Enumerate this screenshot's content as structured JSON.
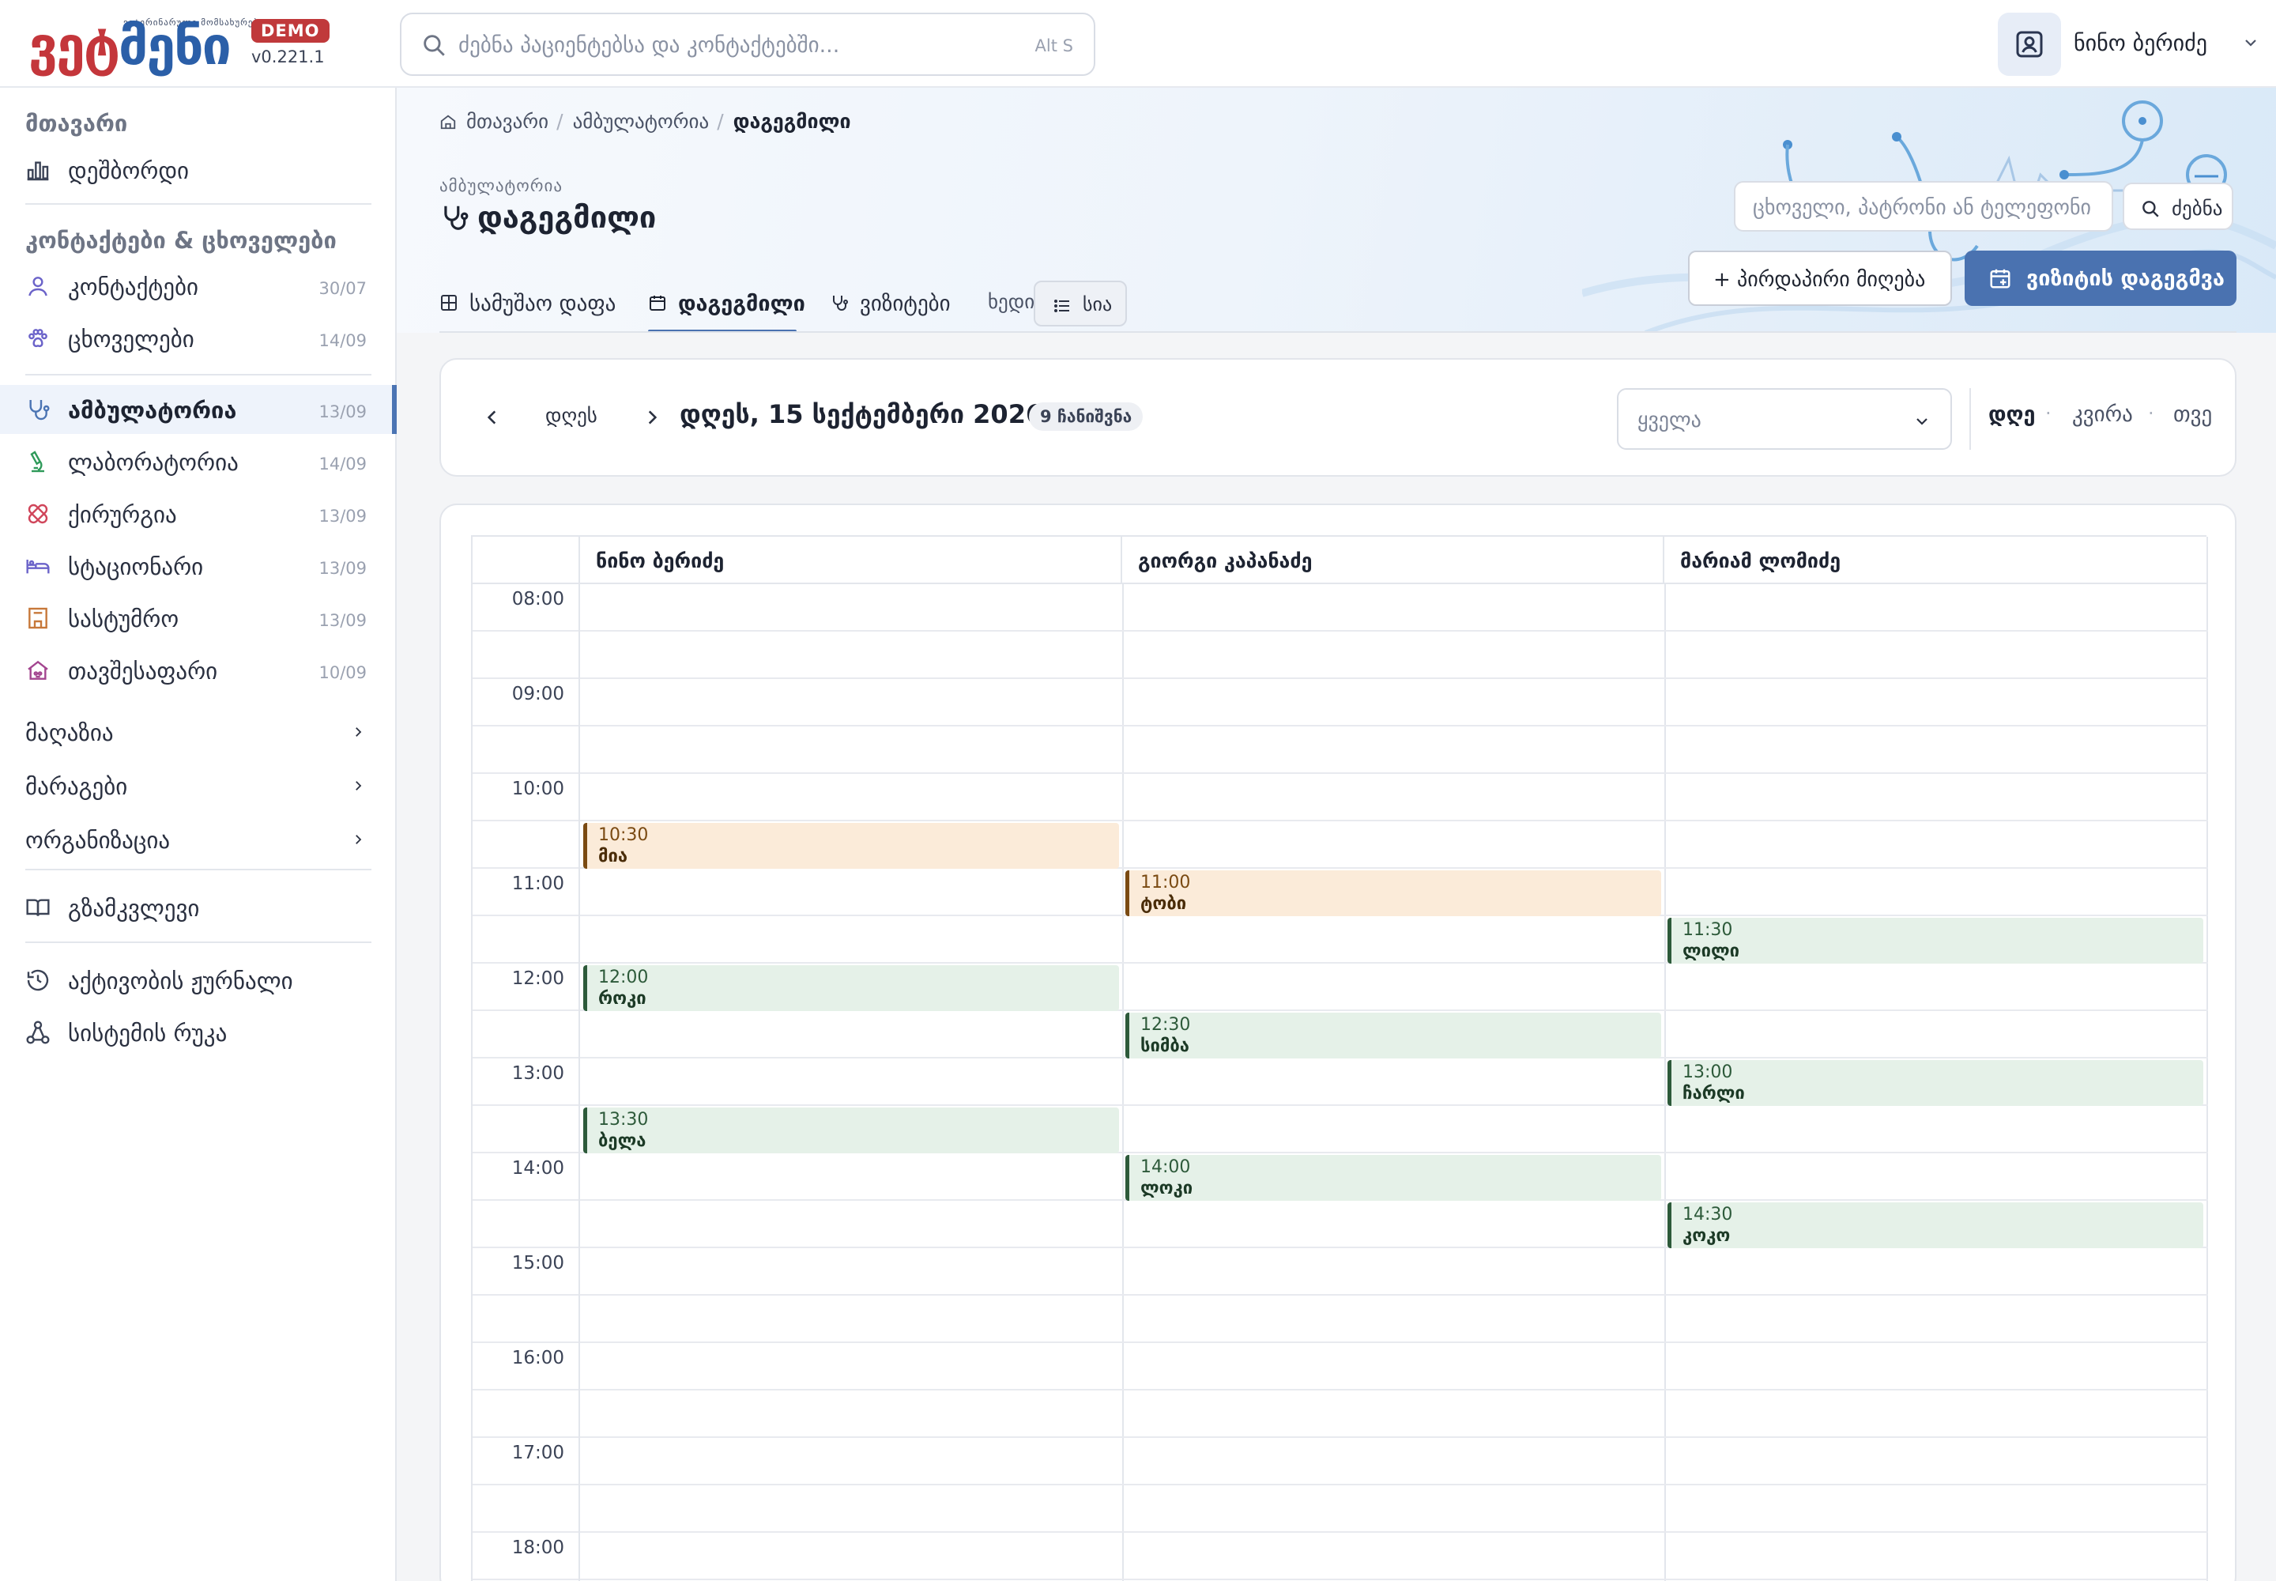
{
  "brand": {
    "tagline": "ვეტერინარული მომსახურება",
    "wordmark_a": "ვეტ",
    "wordmark_b": "მენი",
    "badge": "DEMO",
    "version": "v0.221.1"
  },
  "global_search": {
    "placeholder": "ძებნა პაციენტებსა და კონტაქტებში...",
    "shortcut": "Alt S"
  },
  "user": {
    "name": "ნინო ბერიძე",
    "icon": "user-badge-icon"
  },
  "sidebar": {
    "main_title": "მთავარი",
    "dashboard": "დეშბორდი",
    "contacts_title": "კონტაქტები & ცხოველები",
    "contacts": {
      "label": "კონტაქტები",
      "date": "30/07"
    },
    "animals": {
      "label": "ცხოველები",
      "date": "14/09"
    },
    "modules": [
      {
        "label": "ამბულატორია",
        "date": "13/09",
        "icon": "stethoscope-icon",
        "color": "#4b74b3"
      },
      {
        "label": "ლაბორატორია",
        "date": "14/09",
        "icon": "microscope-icon",
        "color": "#2f9a5a"
      },
      {
        "label": "ქირურგია",
        "date": "13/09",
        "icon": "bandage-icon",
        "color": "#d0455a"
      },
      {
        "label": "სტაციონარი",
        "date": "13/09",
        "icon": "bed-icon",
        "color": "#6b63c9"
      },
      {
        "label": "სასტუმრო",
        "date": "13/09",
        "icon": "hotel-icon",
        "color": "#c7783a"
      },
      {
        "label": "თავშესაფარი",
        "date": "10/09",
        "icon": "shelter-icon",
        "color": "#a3458f"
      }
    ],
    "shop": "მაღაზია",
    "stock": "მარაგები",
    "organization": "ორგანიზაცია",
    "guide": "გზამკვლევი",
    "activity_log": "აქტივობის ჟურნალი",
    "system_map": "სისტემის რუკა"
  },
  "header": {
    "breadcrumb": [
      "მთავარი",
      "ამბულატორია",
      "დაგეგმილი"
    ],
    "eyebrow": "ამბულატორია",
    "title": "დაგეგმილი",
    "search_placeholder": "ცხოველი, პატრონი ან ტელეფონი",
    "search_button": "ძებნა",
    "direct_button": "+ პირდაპირი მიღება",
    "plan_button": "ვიზიტის დაგეგმვა",
    "tabs": [
      "სამუშაო დაფა",
      "დაგეგმილი",
      "ვიზიტები"
    ],
    "view_label": "ხედი:",
    "view_button": "სია"
  },
  "date_nav": {
    "today": "დღეს",
    "date_label": "დღეს, 15 სექტემბერი 2026",
    "count_badge": "9 ჩანიშვნა",
    "filter_value": "ყველა",
    "modes": [
      "დღე",
      "კვირა",
      "თვე"
    ],
    "active_mode": "დღე"
  },
  "calendar": {
    "doctors": [
      "ნინო ბერიძე",
      "გიორგი კაპანაძე",
      "მარიამ ლომიძე"
    ],
    "hours": [
      "08:00",
      "09:00",
      "10:00",
      "11:00",
      "12:00",
      "13:00",
      "14:00",
      "15:00",
      "16:00",
      "17:00",
      "18:00"
    ],
    "slot_minutes": 30,
    "colors": {
      "pending_bg": "#fbebd9",
      "pending_border": "#7a4a12",
      "confirmed_bg": "#e5f1e8",
      "confirmed_border": "#2d5a3a"
    },
    "appointments": [
      {
        "doctor": 0,
        "time": "10:30",
        "pet": "მია",
        "status": "pending"
      },
      {
        "doctor": 1,
        "time": "11:00",
        "pet": "ტობი",
        "status": "pending"
      },
      {
        "doctor": 2,
        "time": "11:30",
        "pet": "ლილი",
        "status": "confirmed"
      },
      {
        "doctor": 0,
        "time": "12:00",
        "pet": "როკი",
        "status": "confirmed"
      },
      {
        "doctor": 1,
        "time": "12:30",
        "pet": "სიმბა",
        "status": "confirmed"
      },
      {
        "doctor": 2,
        "time": "13:00",
        "pet": "ჩარლი",
        "status": "confirmed"
      },
      {
        "doctor": 0,
        "time": "13:30",
        "pet": "ბელა",
        "status": "confirmed"
      },
      {
        "doctor": 1,
        "time": "14:00",
        "pet": "ლოკი",
        "status": "confirmed"
      },
      {
        "doctor": 2,
        "time": "14:30",
        "pet": "კოკო",
        "status": "confirmed"
      }
    ]
  }
}
